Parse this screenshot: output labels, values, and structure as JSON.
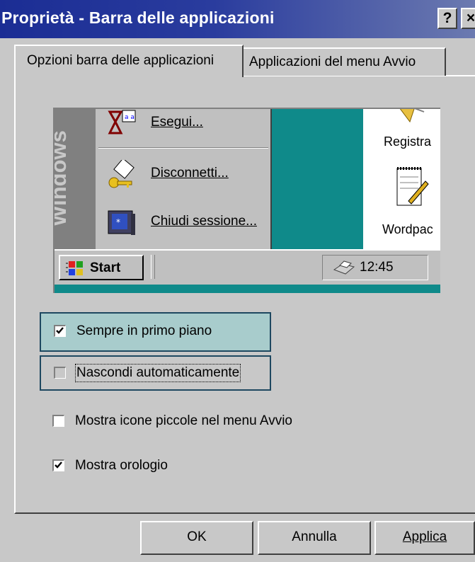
{
  "window": {
    "title": "Proprietà - Barra delle applicazioni",
    "help_button": "?",
    "close_button": "×"
  },
  "tabs": [
    {
      "label": "Opzioni barra delle applicazioni",
      "active": true
    },
    {
      "label": "Applicazioni del menu Avvio",
      "active": false
    }
  ],
  "preview": {
    "stripe_text": "Windows",
    "menu_items": [
      {
        "label": "Esegui...",
        "icon": "run-icon"
      },
      {
        "label": "Disconnetti...",
        "icon": "keys-icon"
      },
      {
        "label": "Chiudi sessione...",
        "icon": "shutdown-computer-icon"
      }
    ],
    "desktop_items": [
      {
        "label": "Registra",
        "icon": "recorder-icon"
      },
      {
        "label": "Wordpac",
        "icon": "notepad-icon"
      }
    ],
    "taskbar": {
      "start_label": "Start",
      "clock": "12:45"
    }
  },
  "options": [
    {
      "label": "Sempre in primo piano",
      "checked": true
    },
    {
      "label": "Nascondi automaticamente",
      "checked": false
    },
    {
      "label": "Mostra icone piccole nel menu Avvio",
      "checked": false
    },
    {
      "label": "Mostra orologio",
      "checked": true
    }
  ],
  "buttons": {
    "ok": "OK",
    "cancel": "Annulla",
    "apply": "Applica"
  },
  "colors": {
    "titlebar": "#1b2d94",
    "desktop": "#0f8a8a",
    "face": "#c8c8c8",
    "highlight_box": "#a8cccc"
  }
}
